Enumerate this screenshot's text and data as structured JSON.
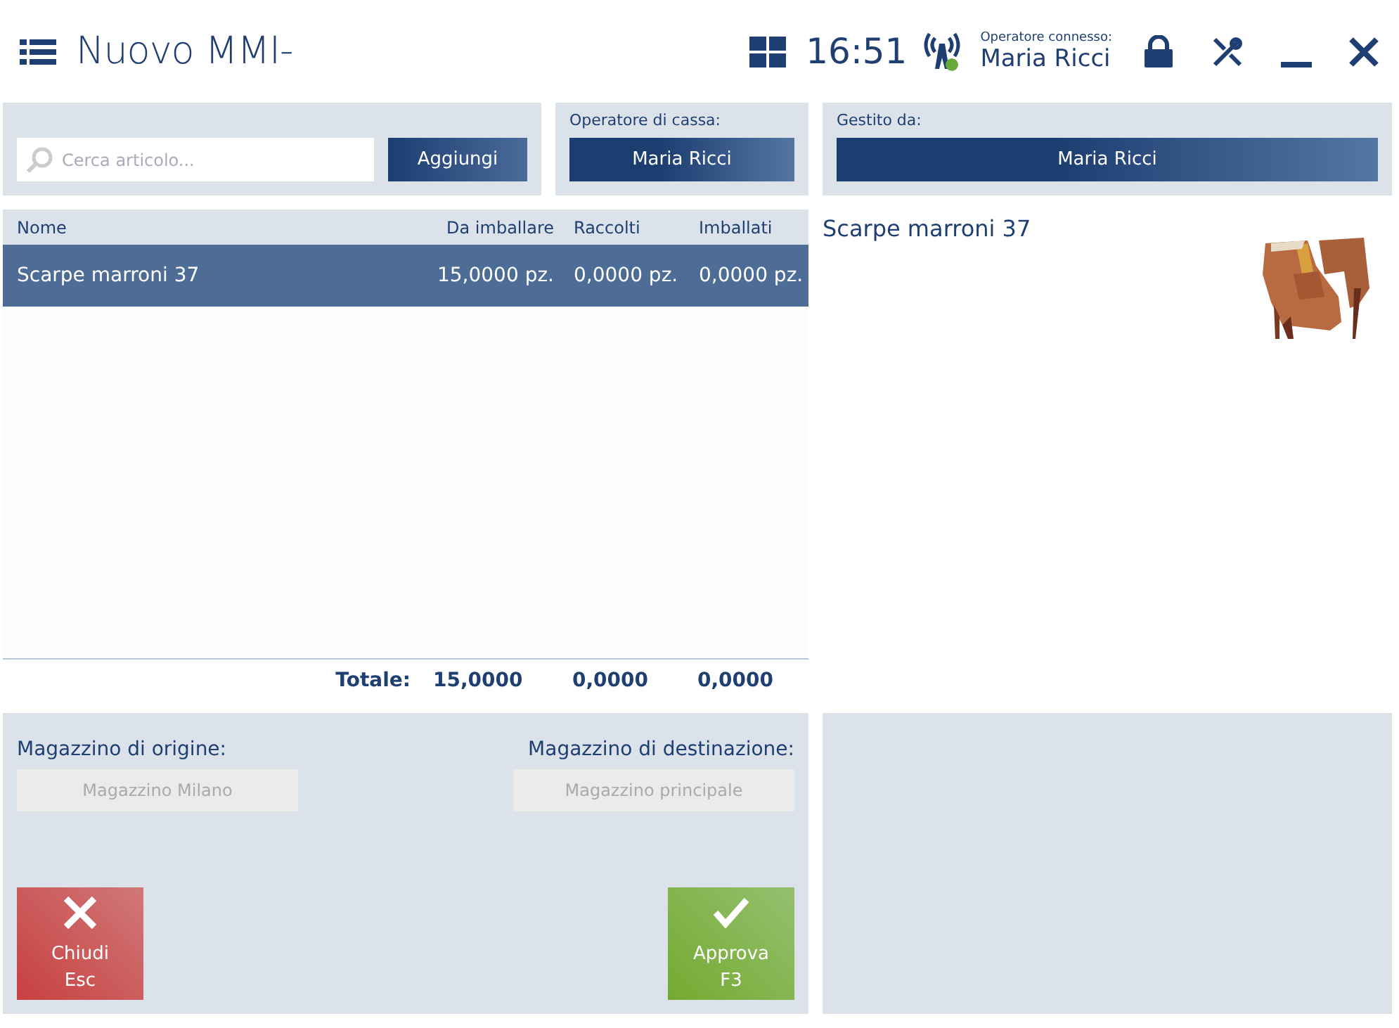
{
  "header": {
    "title": "Nuovo MMI-",
    "time": "16:51",
    "connected": true,
    "operator_label": "Operatore connesso:",
    "operator": "Maria Ricci"
  },
  "search": {
    "placeholder": "Cerca articolo...",
    "button": "Aggiungi"
  },
  "cashier": {
    "label": "Operatore di cassa:",
    "value": "Maria Ricci"
  },
  "managed_by": {
    "label": "Gestito da:",
    "value": "Maria Ricci"
  },
  "table": {
    "columns": [
      "Nome",
      "Da imballare",
      "Raccolti",
      "Imballati"
    ],
    "rows": [
      {
        "cells": [
          "Scarpe marroni 37",
          "15,0000 pz.",
          "0,0000 pz.",
          "0,0000 pz."
        ],
        "selected": true
      }
    ],
    "totals": {
      "label": "Totale:",
      "values": [
        "15,0000",
        "0,0000",
        "0,0000"
      ]
    }
  },
  "detail": {
    "name": "Scarpe marroni 37"
  },
  "warehouses": [
    {
      "label": "Magazzino di origine:",
      "value": "Magazzino Milano",
      "disabled": true
    },
    {
      "label": "Magazzino di destinazione:",
      "value": "Magazzino principale",
      "disabled": true
    }
  ],
  "actions": [
    {
      "kind": "close",
      "label": "Chiudi",
      "key": "Esc"
    },
    {
      "kind": "approve",
      "label": "Approva",
      "key": "F3"
    }
  ]
}
